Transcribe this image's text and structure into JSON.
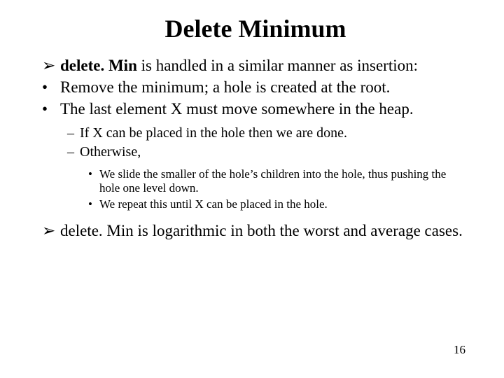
{
  "title": "Delete Minimum",
  "bullets": {
    "intro_bold": "delete. Min",
    "intro_rest": " is handled in a similar manner as insertion:",
    "remove": "Remove the minimum; a hole is created at the root.",
    "last_elem": "The last element X must move somewhere in the heap.",
    "if_placed": "If X can be placed in the hole then we are done.",
    "otherwise": "Otherwise,",
    "slide_child": "We slide the smaller of the hole’s children into the hole, thus pushing the hole one level down.",
    "repeat": "We repeat this until X can be placed in the hole.",
    "logarithmic": "delete. Min is logarithmic in both the worst and average cases."
  },
  "glyphs": {
    "arrow": "➢",
    "dot": "•",
    "endash": "–"
  },
  "page_number": "16"
}
